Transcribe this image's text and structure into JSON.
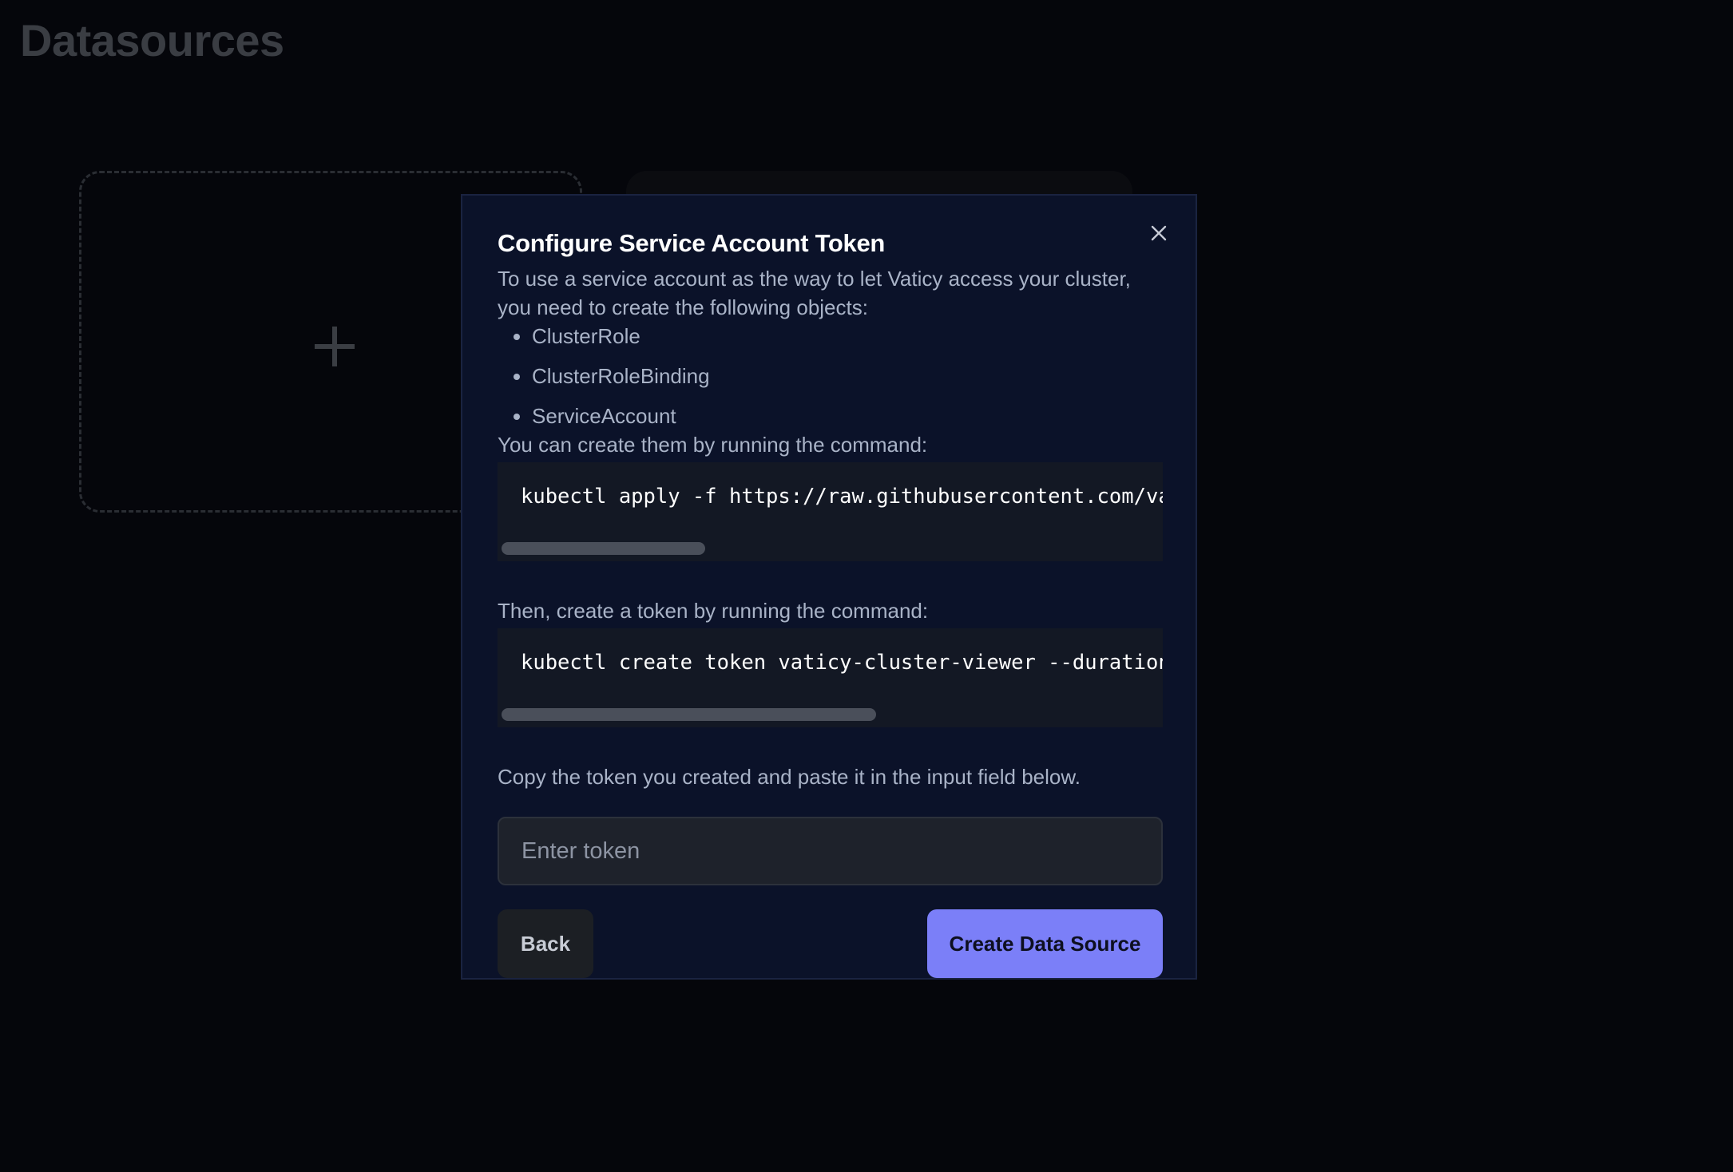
{
  "page": {
    "title": "Datasources"
  },
  "modal": {
    "title": "Configure Service Account Token",
    "intro": "To use a service account as the way to let Vaticy access your cluster, you need to create the following objects:",
    "objects": [
      "ClusterRole",
      "ClusterRoleBinding",
      "ServiceAccount"
    ],
    "command1_label": "You can create them by running the command:",
    "command1": "kubectl apply -f https://raw.githubusercontent.com/va",
    "command1_scroll_fraction": 0.31,
    "command2_label": "Then, create a token by running the command:",
    "command2": "kubectl create token vaticy-cluster-viewer --duration",
    "command2_scroll_fraction": 0.57,
    "copy_instruction": "Copy the token you created and paste it in the input field below.",
    "token_placeholder": "Enter token",
    "token_value": "",
    "back_label": "Back",
    "create_label": "Create Data Source"
  },
  "icons": {
    "close": "close-icon",
    "add": "plus-icon"
  },
  "colors": {
    "background": "#05060b",
    "modal_background": "#0b1229",
    "primary_button": "#7b7ff8",
    "secondary_button": "#1c1f24"
  }
}
